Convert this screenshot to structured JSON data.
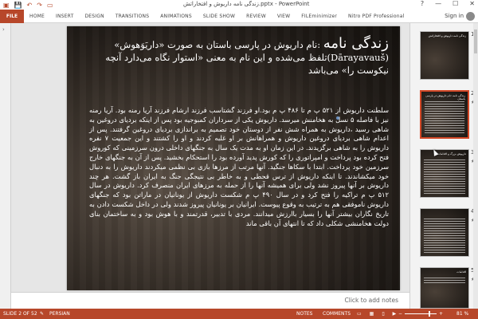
{
  "titlebar": {
    "qat_icons": [
      "save-icon",
      "undo-icon",
      "redo-icon",
      "slideshow-icon"
    ],
    "title": "زندگی نامه داریوش و افتخاراتش.pptx - PowerPoint",
    "help": "?",
    "min": "—",
    "max": "☐",
    "close": "✕"
  },
  "ribbon": {
    "file": "FILE",
    "tabs": [
      "HOME",
      "INSERT",
      "DESIGN",
      "TRANSITIONS",
      "ANIMATIONS",
      "SLIDE SHOW",
      "REVIEW",
      "VIEW",
      "FILEminimizer",
      "Nitro PDF Professional"
    ],
    "user": "Sign in"
  },
  "slide": {
    "title_big": "زندگی نامه",
    "title_rest": ":نام داریوش در پارسی باستان به صورت «داریَوَهوش» (Dārayavauš)تلفظ می‌شده و این نام به معنی «استوار نگاه می‌دارد آنچه نیکوست را» می‌باشد",
    "body": "سلطنت داریوش از ۵۲۱ پ م تا ۴۸۶ پ م بود.او فرزند گشتاسب فرزند ارشام فرزند آریا رمنه بود. آریا رمنه نیز با فاصله ۵ نسل به هخامنش میرسد. داریوش یکی از سرداران کمبوجیه بود پس از اینکه بردیای دروغین به شاهی رسید ،داریوش به همراه شش نفر از دوستان خود تصمیم به براندازی بردیای دروغین گرفتند. پس از اعدام شاهی بردیای دروغین داریوش و همراهانش بر او غلبه کردند و او را کشتند و این جمعیت ۷ نفره داریوش را به شاهی برگزیدند. در این زمان او به مدت یک سال به جنگهای داخلی درون سرزمینی که کوروش فتح کرده بود پرداخت و امپراتوری را که کورش پدید آورده بود را استحکام بخشید. پس از آن به جنگهای خارج سرزمین خود پرداخت. ابتدا با سکاها جنگید. آنها مرتب از مرزها بازی بی نظمی میکردند داریوش را به دنبال خود میکشاندند. تا اینکه داریوش از ترس قحطی و به خاطر بی نتیجگی جنگ به ایران باز گشت. هر چند داریوش بر آنها پیروز نشد ولی برای همیشه آنها را از حمله به مرزهای ایران منصرف کرد. داریوش در سال ۵۱۲ پ م تراکیه را فتح کرد و در سال ۴۹۰ پ م شکست داریوش از یونانیان در ماراتن بود که جنگهای داریوش ناموفقی هم به ترتیب به وقوع پیوست. ایرانیان بر یونانیان پیروز شدند ولی در داخل شکست دادن به تاریخ نگاران بیشتر آنها را بسیار باارزش میدانند. مردی با تدبیر، قدرتمند و با هوش بود و به ساختمان بنای دولت هخامنشی شکلی داد که تا انتهای آن باقی ماند"
  },
  "notes": {
    "placeholder": "Click to add notes"
  },
  "thumbnails": [
    {
      "number": "1",
      "title": "زندگی نامه داریوش و افتخاراتش",
      "star": ""
    },
    {
      "number": "2",
      "title": "زندگی نامه :نام داریوش در پارسی باستان",
      "star": "★"
    },
    {
      "number": "3",
      "title": "داریوش بزرگ و اقدامات",
      "star": "★"
    },
    {
      "number": "4",
      "title": "",
      "star": "★"
    },
    {
      "number": "5",
      "title": "اقدامات",
      "star": "★"
    }
  ],
  "statusbar": {
    "slide_of": "SLIDE 2 OF 52",
    "lang": "PERSIAN",
    "notes": "NOTES",
    "comments": "COMMENTS",
    "zoom_pct": "81 %",
    "zoom_level": 0.81
  },
  "colors": {
    "accent": "#b7472a",
    "selected_thumb": "#d24726"
  }
}
